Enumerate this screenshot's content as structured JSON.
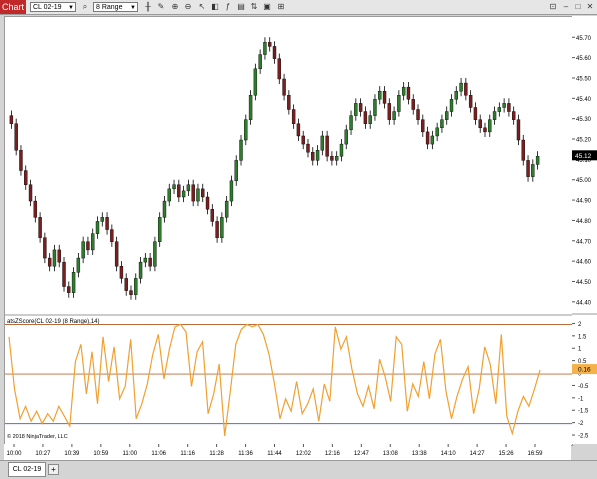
{
  "toolbar": {
    "chart_tab": "Chart",
    "instrument": "CL 02-19",
    "bar_type": "8 Range",
    "icons": [
      "search-icon",
      "bar-style-icon",
      "drawing-tools-icon",
      "zoom-in-icon",
      "zoom-out-icon",
      "pointer-icon",
      "strategies-icon",
      "indicators-icon",
      "properties-icon",
      "chart-trader-icon",
      "data-box-icon",
      "layout-icon"
    ]
  },
  "copyright": "© 2018 NinjaTrader, LLC",
  "indicator_label": "atsZScore(CL 02-19 (8 Range),14)",
  "bottom_tab": "CL 02-19",
  "chart_data": [
    {
      "type": "candlestick",
      "instrument": "CL 02-19",
      "ylim": [
        44.35,
        45.78
      ],
      "y_ticks": [
        "45.70",
        "45.60",
        "45.50",
        "45.40",
        "45.30",
        "45.20",
        "45.10",
        "45.00",
        "44.90",
        "44.80",
        "44.70",
        "44.60",
        "44.50",
        "44.40"
      ],
      "last_price": "45.12",
      "x_tick_labels": [
        "10:00",
        "10:27",
        "10:39",
        "10:59",
        "11:00",
        "11:06",
        "11:16",
        "11:28",
        "11:36",
        "11:44",
        "12:02",
        "12:16",
        "12:47",
        "13:08",
        "13:38",
        "14:10",
        "14:27",
        "15:26",
        "16:59"
      ],
      "close_path": [
        45.28,
        45.15,
        45.05,
        44.98,
        44.9,
        44.82,
        44.72,
        44.62,
        44.58,
        44.66,
        44.6,
        44.48,
        44.45,
        44.55,
        44.62,
        44.7,
        44.66,
        44.74,
        44.8,
        44.82,
        44.76,
        44.7,
        44.58,
        44.52,
        44.46,
        44.44,
        44.52,
        44.6,
        44.62,
        44.58,
        44.7,
        44.82,
        44.9,
        44.96,
        44.98,
        44.92,
        44.95,
        44.98,
        44.9,
        44.96,
        44.92,
        44.86,
        44.8,
        44.72,
        44.82,
        44.9,
        45.0,
        45.1,
        45.2,
        45.3,
        45.42,
        45.55,
        45.62,
        45.68,
        45.66,
        45.6,
        45.5,
        45.42,
        45.35,
        45.28,
        45.22,
        45.18,
        45.14,
        45.1,
        45.15,
        45.22,
        45.12,
        45.1,
        45.12,
        45.18,
        45.25,
        45.32,
        45.38,
        45.34,
        45.28,
        45.32,
        45.4,
        45.44,
        45.38,
        45.3,
        45.34,
        45.42,
        45.46,
        45.4,
        45.35,
        45.3,
        45.24,
        45.18,
        45.22,
        45.26,
        45.3,
        45.34,
        45.4,
        45.44,
        45.48,
        45.42,
        45.36,
        45.3,
        45.26,
        45.24,
        45.3,
        45.34,
        45.36,
        45.38,
        45.34,
        45.3,
        45.2,
        45.1,
        45.02,
        45.08,
        45.12
      ]
    },
    {
      "type": "line",
      "name": "atsZScore(CL 02-19 (8 Range),14)",
      "ylim": [
        -2.7,
        2.3
      ],
      "y_ticks": [
        "2",
        "1.5",
        "1",
        "0.5",
        "0",
        "-0.5",
        "-1",
        "-1.5",
        "-2",
        "-2.5"
      ],
      "upper_band": 2,
      "lower_band": -2,
      "last_value": "0.16",
      "values": [
        1.5,
        -0.6,
        -1.8,
        -1.3,
        -1.9,
        -1.5,
        -2.0,
        -1.6,
        -1.9,
        -1.3,
        -1.7,
        -2.1,
        0.5,
        1.2,
        -0.8,
        0.9,
        -1.2,
        1.5,
        -0.3,
        1.1,
        -1.0,
        -0.5,
        1.4,
        -1.8,
        -1.2,
        -0.4,
        0.8,
        1.6,
        -0.2,
        1.0,
        1.9,
        2.0,
        1.7,
        -0.5,
        0.9,
        1.3,
        -1.6,
        -0.8,
        0.4,
        -2.5,
        -0.7,
        1.2,
        1.8,
        2.0,
        1.9,
        2.0,
        1.6,
        0.8,
        -0.4,
        -1.8,
        -1.0,
        -1.5,
        -0.3,
        -1.6,
        -1.2,
        -0.6,
        -1.9,
        -0.4,
        -1.1,
        1.9,
        1.0,
        1.5,
        0.2,
        -0.8,
        -1.3,
        -0.5,
        -1.4,
        0.6,
        -0.1,
        -1.1,
        1.5,
        1.2,
        -1.5,
        -0.4,
        -0.9,
        0.5,
        -1.0,
        0.8,
        1.4,
        -0.7,
        -1.8,
        -0.9,
        -0.2,
        0.3,
        -1.6,
        -0.6,
        1.1,
        0.4,
        -1.2,
        1.6,
        -1.7,
        -2.4,
        -1.5,
        -0.9,
        -1.3,
        -0.6,
        0.16
      ]
    }
  ]
}
